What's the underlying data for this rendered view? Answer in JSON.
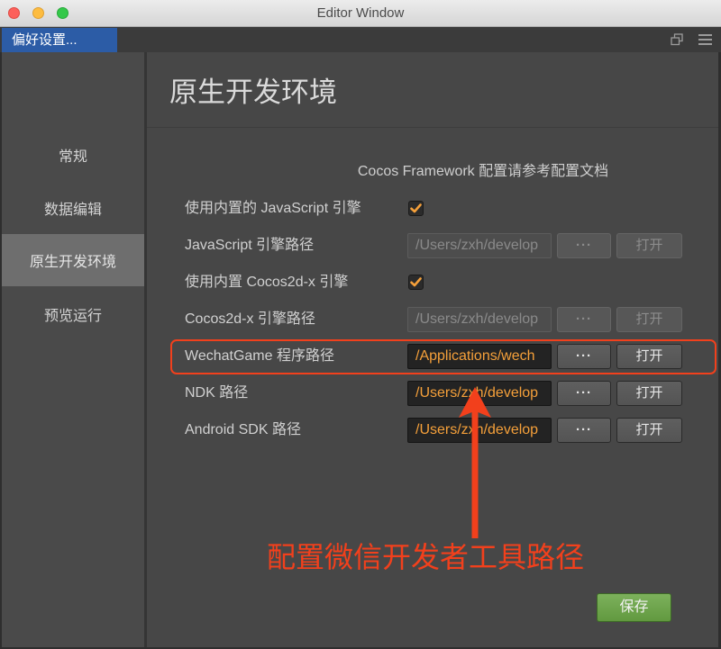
{
  "window": {
    "title": "Editor Window"
  },
  "tabbar": {
    "tabs": [
      {
        "label": "偏好设置...",
        "active": true
      }
    ],
    "icons": [
      "popout-icon",
      "menu-icon"
    ]
  },
  "sidebar": {
    "items": [
      {
        "label": "常规",
        "selected": false
      },
      {
        "label": "数据编辑",
        "selected": false
      },
      {
        "label": "原生开发环境",
        "selected": true
      },
      {
        "label": "预览运行",
        "selected": false
      }
    ]
  },
  "main": {
    "title": "原生开发环境",
    "note": "Cocos Framework 配置请参考配置文档",
    "rows": [
      {
        "label": "使用内置的 JavaScript 引擎",
        "checked": true
      },
      {
        "label": "JavaScript 引擎路径",
        "value": "/Users/zxh/develop",
        "disabled": true
      },
      {
        "label": "使用内置 Cocos2d-x 引擎",
        "checked": true
      },
      {
        "label": "Cocos2d-x 引擎路径",
        "value": "/Users/zxh/develop",
        "disabled": true
      },
      {
        "label": "WechatGame 程序路径",
        "value": "/Applications/wech",
        "disabled": false
      },
      {
        "label": "NDK 路径",
        "value": "/Users/zxh/develop",
        "disabled": false
      },
      {
        "label": "Android SDK 路径",
        "value": "/Users/zxh/develop",
        "disabled": false
      }
    ],
    "browse_label": "···",
    "open_label": "打开",
    "save_label": "保存"
  },
  "annotation": {
    "text": "配置微信开发者工具路径",
    "arrow_icon": "arrow-up-icon"
  },
  "colors": {
    "accent": "#f5a03a",
    "annotation": "#f2401c",
    "tab_active": "#2c5ca6",
    "sidebar_selected": "#6e6e6e",
    "save": "#6aa645"
  }
}
